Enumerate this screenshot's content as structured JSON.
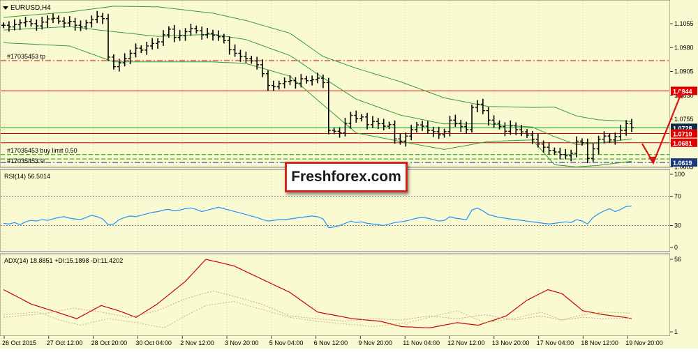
{
  "window": {
    "symbol_title": "EURUSD,H4"
  },
  "colors": {
    "background": "#fafad2",
    "grid": "#c8c8a0",
    "candles": "#000000",
    "bollinger": "#3a9a3a",
    "rsi_line": "#1e90ff",
    "adx_line": "#cc0000",
    "di_plus": "#c0c060",
    "di_minus": "#d4a090",
    "tp_line": "#cc0000",
    "buy_limit_line": "#00a000",
    "sl_line": "#2020c0",
    "resistance_line": "#cc0000",
    "support_line": "#00a000",
    "arrow": "#dd1111"
  },
  "main_panel": {
    "order_labels": {
      "tp": "#17035453 tp",
      "buy_limit": "#17035453 buy limit 0.50",
      "sl": "#17035453 sl"
    },
    "price_axis_ticks": [
      "1.1055",
      "1.0980",
      "1.0905",
      "1.0830",
      "1.0755",
      "1.0680",
      "1.0605"
    ],
    "price_markers": [
      {
        "text": "1.0844",
        "bg": "#e00000",
        "fg": "#ffffff"
      },
      {
        "text": "1.0728",
        "bg": "#0c2d4a",
        "fg": "#ffffff"
      },
      {
        "text": "1.0710",
        "bg": "#e00000",
        "fg": "#ffffff"
      },
      {
        "text": "1.0681",
        "bg": "#e00000",
        "fg": "#ffffff"
      },
      {
        "text": "1.0619",
        "bg": "#1a3a80",
        "fg": "#ffffff"
      }
    ],
    "arrow": {
      "from_price": 1.0678,
      "down_to_price": 1.0618,
      "up_to_price": 1.0844
    },
    "watermark": "Freshforex.com"
  },
  "rsi_panel": {
    "title": "RSI(14) 56.5014",
    "axis_ticks": [
      "100",
      "70",
      "30",
      "0"
    ],
    "levels": [
      70,
      30
    ]
  },
  "adx_panel": {
    "title": "ADX(14) 18.8851 +DI:15.1898 -DI:11.4202",
    "axis_ticks": [
      "56",
      "1"
    ]
  },
  "time_axis": [
    "26 Oct 2015",
    "27 Oct 12:00",
    "28 Oct 20:00",
    "30 Oct 04:00",
    "2 Nov 12:00",
    "3 Nov 20:00",
    "5 Nov 04:00",
    "6 Nov 12:00",
    "9 Nov 20:00",
    "11 Nov 04:00",
    "12 Nov 12:00",
    "13 Nov 20:00",
    "17 Nov 04:00",
    "18 Nov 12:00",
    "19 Nov 20:00"
  ],
  "chart_data": [
    {
      "type": "line",
      "name": "price",
      "title": "EURUSD,H4",
      "series_kind": "ohlc_closes",
      "ylim": [
        1.0595,
        1.111
      ],
      "horizontal_lines": [
        {
          "label": "#17035453 tp",
          "price": 1.0939,
          "style": "dash-dot"
        },
        {
          "price": 1.0844,
          "style": "solid"
        },
        {
          "price": 1.0728,
          "style": "solid"
        },
        {
          "price": 1.071,
          "style": "solid"
        },
        {
          "price": 1.0681,
          "style": "solid"
        },
        {
          "label": "#17035453 buy limit 0.50",
          "price": 1.0644,
          "style": "dashed"
        },
        {
          "price": 1.063,
          "style": "dashed"
        },
        {
          "label": "#17035453 sl",
          "price": 1.0619,
          "style": "dash-dot"
        }
      ],
      "closes": [
        1.105,
        1.1045,
        1.1052,
        1.1058,
        1.1062,
        1.1055,
        1.1048,
        1.106,
        1.107,
        1.1072,
        1.1063,
        1.1057,
        1.1062,
        1.105,
        1.1045,
        1.1058,
        1.1068,
        1.1078,
        1.1071,
        1.095,
        1.092,
        1.0932,
        1.0945,
        1.0962,
        1.0978,
        1.0972,
        1.0985,
        1.0993,
        1.0998,
        1.102,
        1.1038,
        1.1012,
        1.1018,
        1.103,
        1.104,
        1.1033,
        1.102,
        1.1025,
        1.1019,
        1.1014,
        1.1002,
        1.0973,
        1.0962,
        1.0952,
        1.0945,
        1.0938,
        1.0926,
        1.0898,
        1.0861,
        1.0857,
        1.0867,
        1.0873,
        1.0876,
        1.0868,
        1.0882,
        1.0876,
        1.0879,
        1.0884,
        1.087,
        1.072,
        1.0717,
        1.0712,
        1.0742,
        1.0767,
        1.0757,
        1.0762,
        1.0738,
        1.0748,
        1.0741,
        1.0733,
        1.0738,
        1.0693,
        1.0686,
        1.0702,
        1.0722,
        1.0737,
        1.0733,
        1.072,
        1.0716,
        1.0706,
        1.0716,
        1.0752,
        1.0742,
        1.0732,
        1.0722,
        1.0792,
        1.0802,
        1.0782,
        1.0752,
        1.0742,
        1.0732,
        1.0717,
        1.0734,
        1.0722,
        1.0715,
        1.0705,
        1.0692,
        1.0677,
        1.0667,
        1.0657,
        1.0652,
        1.0644,
        1.064,
        1.0648,
        1.0686,
        1.0681,
        1.0632,
        1.0662,
        1.0692,
        1.0702,
        1.069,
        1.07,
        1.072,
        1.0741,
        1.0728
      ],
      "x": [
        "26 Oct 2015",
        "27 Oct 12:00",
        "28 Oct 20:00",
        "30 Oct 04:00",
        "2 Nov 12:00",
        "3 Nov 20:00",
        "5 Nov 04:00",
        "6 Nov 12:00",
        "9 Nov 20:00",
        "11 Nov 04:00",
        "12 Nov 12:00",
        "13 Nov 20:00",
        "17 Nov 04:00",
        "18 Nov 12:00",
        "19 Nov 20:00"
      ],
      "bollinger": {
        "upper_anchors": [
          [
            0,
            1.1075
          ],
          [
            12,
            1.1092
          ],
          [
            20,
            1.111
          ],
          [
            28,
            1.1108
          ],
          [
            38,
            1.1088
          ],
          [
            44,
            1.1065
          ],
          [
            52,
            1.1025
          ],
          [
            58,
            1.0952
          ],
          [
            64,
            1.0915
          ],
          [
            72,
            1.0873
          ],
          [
            80,
            1.0822
          ],
          [
            88,
            1.0795
          ],
          [
            96,
            1.0792
          ],
          [
            100,
            1.0793
          ],
          [
            104,
            1.0765
          ],
          [
            108,
            1.0753
          ],
          [
            114,
            1.0748
          ]
        ],
        "middle_anchors": [
          [
            0,
            1.1035
          ],
          [
            12,
            1.1046
          ],
          [
            20,
            1.103
          ],
          [
            28,
            1.1015
          ],
          [
            38,
            1.1022
          ],
          [
            44,
            1.1005
          ],
          [
            52,
            1.0955
          ],
          [
            58,
            1.0885
          ],
          [
            64,
            1.0818
          ],
          [
            72,
            1.0768
          ],
          [
            80,
            1.074
          ],
          [
            88,
            1.074
          ],
          [
            96,
            1.073
          ],
          [
            100,
            1.07
          ],
          [
            104,
            1.0675
          ],
          [
            108,
            1.068
          ],
          [
            114,
            1.0693
          ]
        ],
        "lower_anchors": [
          [
            0,
            1.0995
          ],
          [
            12,
            1.0985
          ],
          [
            20,
            1.0935
          ],
          [
            28,
            1.0935
          ],
          [
            38,
            1.0935
          ],
          [
            44,
            1.093
          ],
          [
            52,
            1.089
          ],
          [
            58,
            1.08
          ],
          [
            64,
            1.0712
          ],
          [
            72,
            1.0685
          ],
          [
            80,
            1.066
          ],
          [
            88,
            1.0685
          ],
          [
            96,
            1.069
          ],
          [
            100,
            1.0612
          ],
          [
            104,
            1.0605
          ],
          [
            108,
            1.061
          ],
          [
            114,
            1.0623
          ]
        ]
      }
    },
    {
      "type": "line",
      "name": "RSI(14)",
      "title": "RSI(14) 56.5014",
      "ylim": [
        0,
        100
      ],
      "levels": [
        70,
        30
      ],
      "values": [
        33,
        32,
        34,
        31,
        35,
        37,
        36,
        38,
        37,
        39,
        41,
        42,
        40,
        39,
        38,
        41,
        44,
        42,
        39,
        31,
        32,
        38,
        41,
        43,
        42,
        44,
        46,
        48,
        49,
        51,
        52,
        50,
        51,
        53,
        54,
        52,
        49,
        51,
        53,
        55,
        53,
        51,
        49,
        47,
        45,
        43,
        41,
        38,
        36,
        37,
        38,
        38,
        39,
        40,
        41,
        42,
        43,
        42,
        39,
        27,
        28,
        30,
        33,
        36,
        34,
        35,
        33,
        32,
        31,
        30,
        32,
        34,
        35,
        36,
        38,
        40,
        41,
        40,
        38,
        36,
        37,
        42,
        40,
        39,
        38,
        51,
        54,
        50,
        45,
        43,
        41,
        40,
        39,
        38,
        37,
        36,
        35,
        34,
        33,
        32,
        33,
        34,
        35,
        34,
        38,
        36,
        32,
        41,
        46,
        50,
        53,
        49,
        52,
        56,
        56.5
      ],
      "x": [
        "26 Oct 2015",
        "27 Oct 12:00",
        "28 Oct 20:00",
        "30 Oct 04:00",
        "2 Nov 12:00",
        "3 Nov 20:00",
        "5 Nov 04:00",
        "6 Nov 12:00",
        "9 Nov 20:00",
        "11 Nov 04:00",
        "12 Nov 12:00",
        "13 Nov 20:00",
        "17 Nov 04:00",
        "18 Nov 12:00",
        "19 Nov 20:00"
      ]
    },
    {
      "type": "line",
      "name": "ADX(14)",
      "title": "ADX(14) 18.8851 +DI:15.1898 -DI:11.4202",
      "series": [
        {
          "name": "ADX(14)",
          "anchors": [
            [
              0,
              33
            ],
            [
              8,
              22
            ],
            [
              14,
              17
            ],
            [
              21,
              11
            ],
            [
              28,
              21
            ],
            [
              33,
              17
            ],
            [
              38,
              12
            ],
            [
              44,
              22
            ],
            [
              52,
              39
            ],
            [
              58,
              56
            ],
            [
              66,
              51
            ],
            [
              74,
              41
            ],
            [
              82,
              31
            ],
            [
              90,
              16
            ],
            [
              96,
              13
            ],
            [
              100,
              11
            ],
            [
              108,
              9
            ],
            [
              114,
              5
            ],
            [
              122,
              4
            ],
            [
              130,
              8
            ],
            [
              136,
              6
            ],
            [
              144,
              13
            ],
            [
              150,
              25
            ],
            [
              156,
              33
            ],
            [
              160,
              30
            ],
            [
              166,
              17
            ],
            [
              172,
              14
            ],
            [
              178,
              12
            ],
            [
              180,
              11
            ]
          ]
        },
        {
          "name": "+DI",
          "anchors": [
            [
              0,
              14
            ],
            [
              10,
              16
            ],
            [
              16,
              10
            ],
            [
              22,
              6
            ],
            [
              30,
              11
            ],
            [
              38,
              8
            ],
            [
              46,
              4
            ],
            [
              52,
              13
            ],
            [
              58,
              21
            ],
            [
              66,
              24
            ],
            [
              74,
              18
            ],
            [
              82,
              12
            ],
            [
              90,
              9
            ],
            [
              98,
              7
            ],
            [
              106,
              5
            ],
            [
              116,
              8
            ],
            [
              122,
              12
            ],
            [
              130,
              17
            ],
            [
              138,
              8
            ],
            [
              146,
              11
            ],
            [
              154,
              16
            ],
            [
              160,
              10
            ],
            [
              166,
              14
            ],
            [
              172,
              16
            ],
            [
              180,
              15.2
            ]
          ]
        },
        {
          "name": "-DI",
          "anchors": [
            [
              0,
              12
            ],
            [
              12,
              15
            ],
            [
              20,
              19
            ],
            [
              28,
              16
            ],
            [
              36,
              12
            ],
            [
              44,
              17
            ],
            [
              52,
              26
            ],
            [
              60,
              32
            ],
            [
              66,
              28
            ],
            [
              74,
              22
            ],
            [
              82,
              13
            ],
            [
              90,
              11
            ],
            [
              98,
              9
            ],
            [
              106,
              11
            ],
            [
              114,
              10
            ],
            [
              122,
              13
            ],
            [
              130,
              11
            ],
            [
              138,
              14
            ],
            [
              146,
              10
            ],
            [
              154,
              13
            ],
            [
              160,
              10
            ],
            [
              166,
              12
            ],
            [
              172,
              11
            ],
            [
              180,
              11.4
            ]
          ]
        }
      ],
      "x": [
        "26 Oct 2015",
        "27 Oct 12:00",
        "28 Oct 20:00",
        "30 Oct 04:00",
        "2 Nov 12:00",
        "3 Nov 20:00",
        "5 Nov 04:00",
        "6 Nov 12:00",
        "9 Nov 20:00",
        "11 Nov 04:00",
        "12 Nov 12:00",
        "13 Nov 20:00",
        "17 Nov 04:00",
        "18 Nov 12:00",
        "19 Nov 20:00"
      ]
    }
  ]
}
